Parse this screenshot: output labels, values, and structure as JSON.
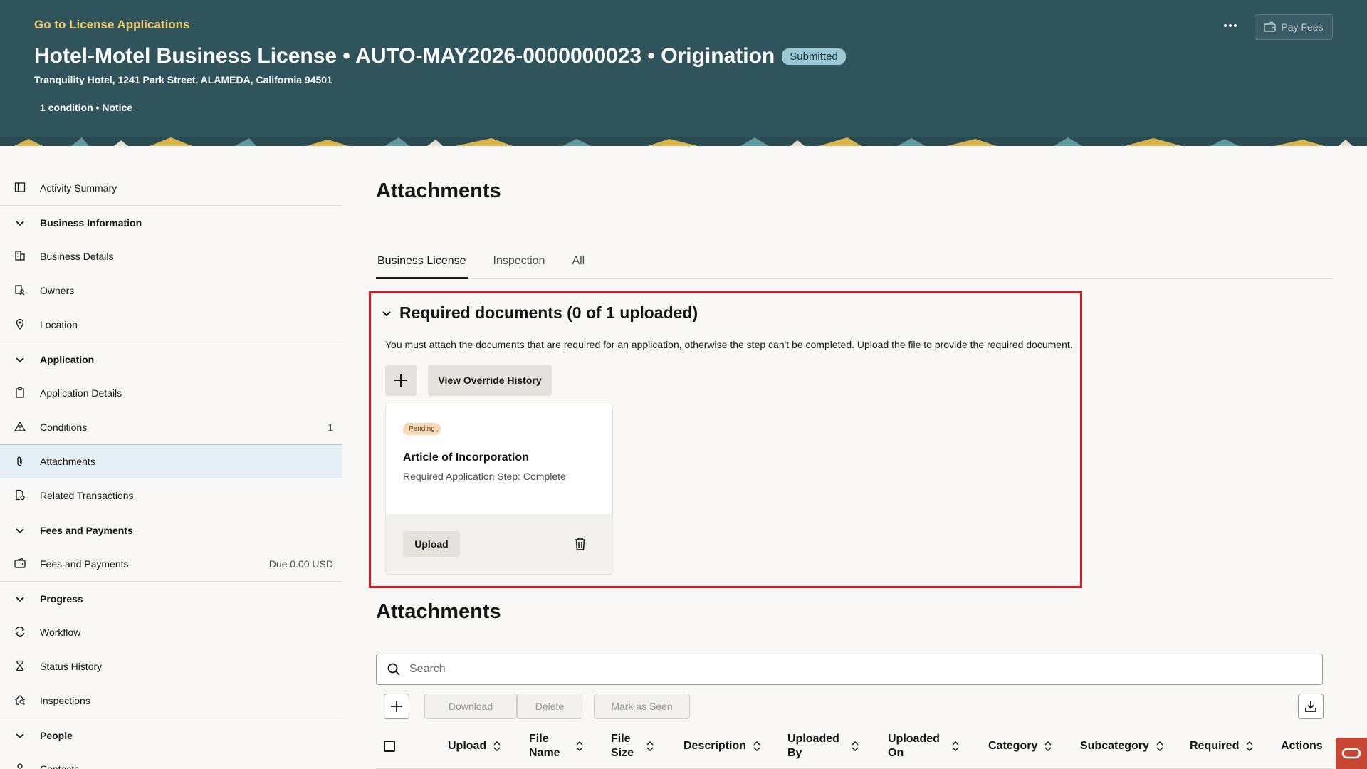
{
  "header": {
    "back_link": "Go to License Applications",
    "title": "Hotel-Motel Business License • AUTO-MAY2026-0000000023 • Origination",
    "status": "Submitted",
    "address": "Tranquility Hotel, 1241 Park Street, ALAMEDA, California 94501",
    "conditions": "1 condition • Notice",
    "pay_fees": "Pay Fees"
  },
  "sidebar": {
    "activity_summary": "Activity Summary",
    "business_information": "Business Information",
    "business_details": "Business Details",
    "owners": "Owners",
    "location": "Location",
    "application": "Application",
    "application_details": "Application Details",
    "conditions": "Conditions",
    "conditions_count": "1",
    "attachments": "Attachments",
    "related_transactions": "Related Transactions",
    "fees_and_payments_section": "Fees and Payments",
    "fees_and_payments": "Fees and Payments",
    "fees_due": "Due 0.00 USD",
    "progress": "Progress",
    "workflow": "Workflow",
    "status_history": "Status History",
    "inspections": "Inspections",
    "people": "People",
    "contacts": "Contacts"
  },
  "main": {
    "title": "Attachments",
    "tabs": [
      "Business License",
      "Inspection",
      "All"
    ],
    "required": {
      "title": "Required documents (0 of 1 uploaded)",
      "description": "You must attach the documents that are required for an application, otherwise the step can't be completed. Upload the file to provide the required document.",
      "view_override_history": "View Override History",
      "card": {
        "status": "Pending",
        "name": "Article of Incorporation",
        "step": "Required Application Step: Complete",
        "upload": "Upload"
      }
    },
    "attachments": {
      "title": "Attachments",
      "search_placeholder": "Search",
      "download": "Download",
      "delete": "Delete",
      "mark_as_seen": "Mark as Seen",
      "columns": [
        "Upload",
        "File Name",
        "File Size",
        "Description",
        "Uploaded By",
        "Uploaded On",
        "Category",
        "Subcategory",
        "Required",
        "Actions"
      ]
    }
  }
}
